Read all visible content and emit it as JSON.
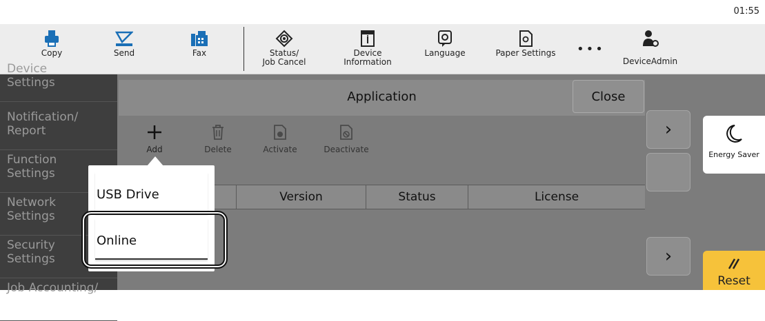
{
  "status": {
    "clock": "01:55"
  },
  "toolbar": {
    "copy": "Copy",
    "send": "Send",
    "fax": "Fax",
    "status_line1": "Status/",
    "status_line2": "Job Cancel",
    "device_line1": "Device",
    "device_line2": "Information",
    "language": "Language",
    "paper": "Paper Settings",
    "more": "•••",
    "user": "DeviceAdmin"
  },
  "nav": {
    "items": [
      {
        "line1": "Device",
        "line2": "Settings"
      },
      {
        "line1": "Notification/",
        "line2": "Report"
      },
      {
        "line1": "Function",
        "line2": "Settings"
      },
      {
        "line1": "Network",
        "line2": "Settings"
      },
      {
        "line1": "Security",
        "line2": "Settings"
      },
      {
        "line1": "Job Accounting/",
        "line2": ""
      }
    ]
  },
  "dialog": {
    "title": "Application",
    "close": "Close",
    "actions": {
      "add": "Add",
      "delete": "Delete",
      "activate": "Activate",
      "deactivate": "Deactivate"
    },
    "columns": [
      "Version",
      "Status",
      "License"
    ]
  },
  "popup": {
    "items": [
      "USB Drive",
      "Online"
    ]
  },
  "right": {
    "energy": "Energy Saver",
    "reset": "Reset"
  },
  "colors": {
    "reset_accent": "#f6c23a",
    "nav_bg": "#3e3e3e",
    "overlay": "#7c7c7c"
  }
}
